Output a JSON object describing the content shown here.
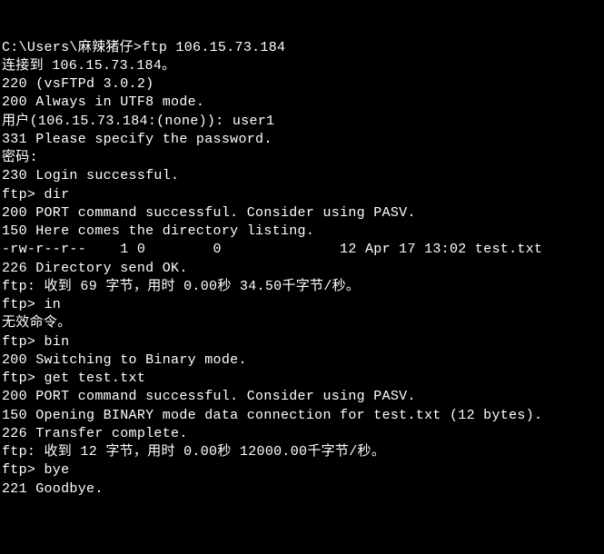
{
  "terminal": {
    "lines": [
      "C:\\Users\\麻辣猪仔>ftp 106.15.73.184",
      "连接到 106.15.73.184。",
      "220 (vsFTPd 3.0.2)",
      "200 Always in UTF8 mode.",
      "用户(106.15.73.184:(none)): user1",
      "331 Please specify the password.",
      "密码:",
      "230 Login successful.",
      "ftp> dir",
      "200 PORT command successful. Consider using PASV.",
      "150 Here comes the directory listing.",
      "-rw-r--r--    1 0        0              12 Apr 17 13:02 test.txt",
      "226 Directory send OK.",
      "ftp: 收到 69 字节，用时 0.00秒 34.50千字节/秒。",
      "ftp> in",
      "无效命令。",
      "ftp> bin",
      "200 Switching to Binary mode.",
      "ftp> get test.txt",
      "200 PORT command successful. Consider using PASV.",
      "150 Opening BINARY mode data connection for test.txt (12 bytes).",
      "226 Transfer complete.",
      "ftp: 收到 12 字节，用时 0.00秒 12000.00千字节/秒。",
      "ftp> bye",
      "221 Goodbye."
    ]
  }
}
